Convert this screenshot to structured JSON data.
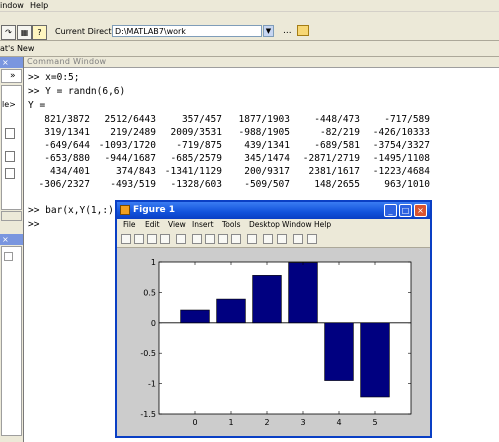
{
  "menubar": {
    "items": [
      "indow",
      "Help"
    ]
  },
  "toolbar": {
    "current_directory_label": "Current Directory:",
    "current_directory_value": "D:\\MATLAB7\\work",
    "browse_label": "..."
  },
  "shortcut_bar": {
    "label": "at's New"
  },
  "left_pane": {
    "fragment_1": "»",
    "fragment_2": "le>"
  },
  "command_window": {
    "title": "Command Window",
    "lines": [
      ">> x=0:5;",
      ">> Y = randn(6,6)",
      "Y ="
    ],
    "matrix": [
      [
        "821/3872",
        "2512/6443",
        "357/457",
        "1877/1903",
        "-448/473",
        "-717/589"
      ],
      [
        "319/1341",
        "219/2489",
        "2009/3531",
        "-988/1905",
        "-82/219",
        "-426/10333"
      ],
      [
        "-649/644",
        "-1093/1720",
        "-719/875",
        "439/1341",
        "-689/581",
        "-3754/3327"
      ],
      [
        "-653/880",
        "-944/1687",
        "-685/2579",
        "345/1474",
        "-2871/2719",
        "-1495/1108"
      ],
      [
        "434/401",
        "374/843",
        "-1341/1129",
        "200/9317",
        "2381/1617",
        "-1223/4684"
      ],
      [
        "-306/2327",
        "-493/519",
        "-1328/603",
        "-509/507",
        "148/2655",
        "963/1010"
      ]
    ],
    "bar_command": ">> bar(x,Y(1,:))",
    "prompt": ">>"
  },
  "figure": {
    "title": "Figure 1",
    "menu": [
      "File",
      "Edit",
      "View",
      "Insert",
      "Tools",
      "Desktop",
      "Window",
      "Help"
    ],
    "toolbar_icons": [
      "new-icon",
      "open-icon",
      "save-icon",
      "print-icon",
      "pointer-icon",
      "zoom-in-icon",
      "zoom-out-icon",
      "pan-icon",
      "rotate-icon",
      "data-cursor-icon",
      "colorbar-icon",
      "legend-icon",
      "hide-plot-tools-icon",
      "show-plot-tools-icon"
    ]
  },
  "chart_data": {
    "type": "bar",
    "categories": [
      "0",
      "1",
      "2",
      "3",
      "4",
      "5"
    ],
    "values": [
      0.21,
      0.39,
      0.78,
      0.99,
      -0.95,
      -1.22
    ],
    "ylim": [
      -1.5,
      1
    ],
    "yticks": [
      "-1.5",
      "-1",
      "-0.5",
      "0",
      "0.5",
      "1"
    ],
    "bar_color": "#000080",
    "title": "",
    "xlabel": "",
    "ylabel": ""
  }
}
